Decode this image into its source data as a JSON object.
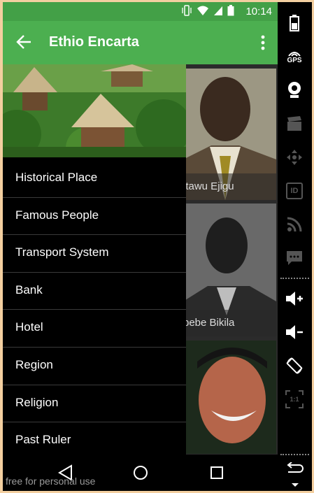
{
  "status_bar": {
    "time": "10:14"
  },
  "toolbar": {
    "title": "Ethio Encarta",
    "back_icon": "arrow-left-icon",
    "overflow_icon": "more-vertical-icon",
    "color": "#4caf50"
  },
  "drawer": {
    "menu_items": [
      {
        "label": "Historical Place"
      },
      {
        "label": "Famous People"
      },
      {
        "label": "Transport System"
      },
      {
        "label": "Bank"
      },
      {
        "label": "Hotel"
      },
      {
        "label": "Region"
      },
      {
        "label": "Religion"
      },
      {
        "label": "Past Ruler"
      }
    ]
  },
  "content": {
    "cards": [
      {
        "caption": "itawu Ejigu"
      },
      {
        "caption": "bebe Bikila"
      },
      {
        "caption": ""
      }
    ]
  },
  "navbar": {
    "back_icon": "triangle-back-icon",
    "home_icon": "circle-home-icon",
    "recents_icon": "square-recents-icon"
  },
  "watermark": "free for personal use",
  "side_panel": {
    "gps_label": "GPS",
    "id_label": "ID",
    "scale_label": "1:1"
  }
}
